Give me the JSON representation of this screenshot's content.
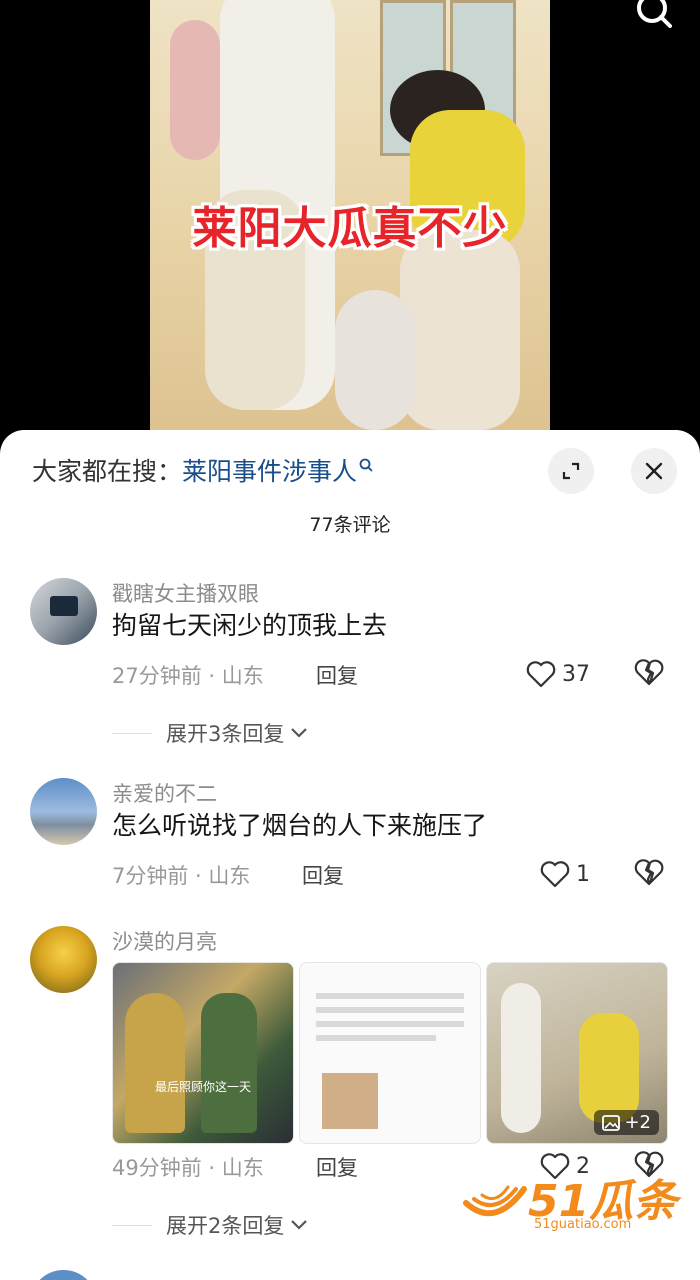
{
  "video": {
    "title": "莱阳大瓜真不少"
  },
  "panel": {
    "trending_label": "大家都在搜：",
    "trending_link": "莱阳事件涉事人",
    "comment_count": "77条评论"
  },
  "comments": [
    {
      "username": "戳瞎女主播双眼",
      "text": "拘留七天闲少的顶我上去",
      "time": "27分钟前",
      "location": "山东",
      "reply_label": "回复",
      "likes": "37",
      "expand_label": "展开3条回复"
    },
    {
      "username": "亲爱的不二",
      "text": "怎么听说找了烟台的人下来施压了",
      "time": "7分钟前",
      "location": "山东",
      "reply_label": "回复",
      "likes": "1"
    },
    {
      "username": "沙漠的月亮",
      "text": "",
      "time": "49分钟前",
      "location": "山东",
      "reply_label": "回复",
      "likes": "2",
      "expand_label": "展开2条回复",
      "image_caption": "最后照顾你这一天",
      "more_images": "+2"
    }
  ],
  "colors": {
    "title_red": "#e8242b",
    "link_blue": "#1a4e8a",
    "watermark_orange": "#f28a1c"
  },
  "icons": [
    "search-icon",
    "expand-icon",
    "close-icon",
    "heart-icon",
    "broken-heart-icon",
    "chevron-down-icon",
    "image-icon"
  ],
  "watermark": {
    "brand": "51瓜条",
    "url": "51guatiao.com"
  }
}
